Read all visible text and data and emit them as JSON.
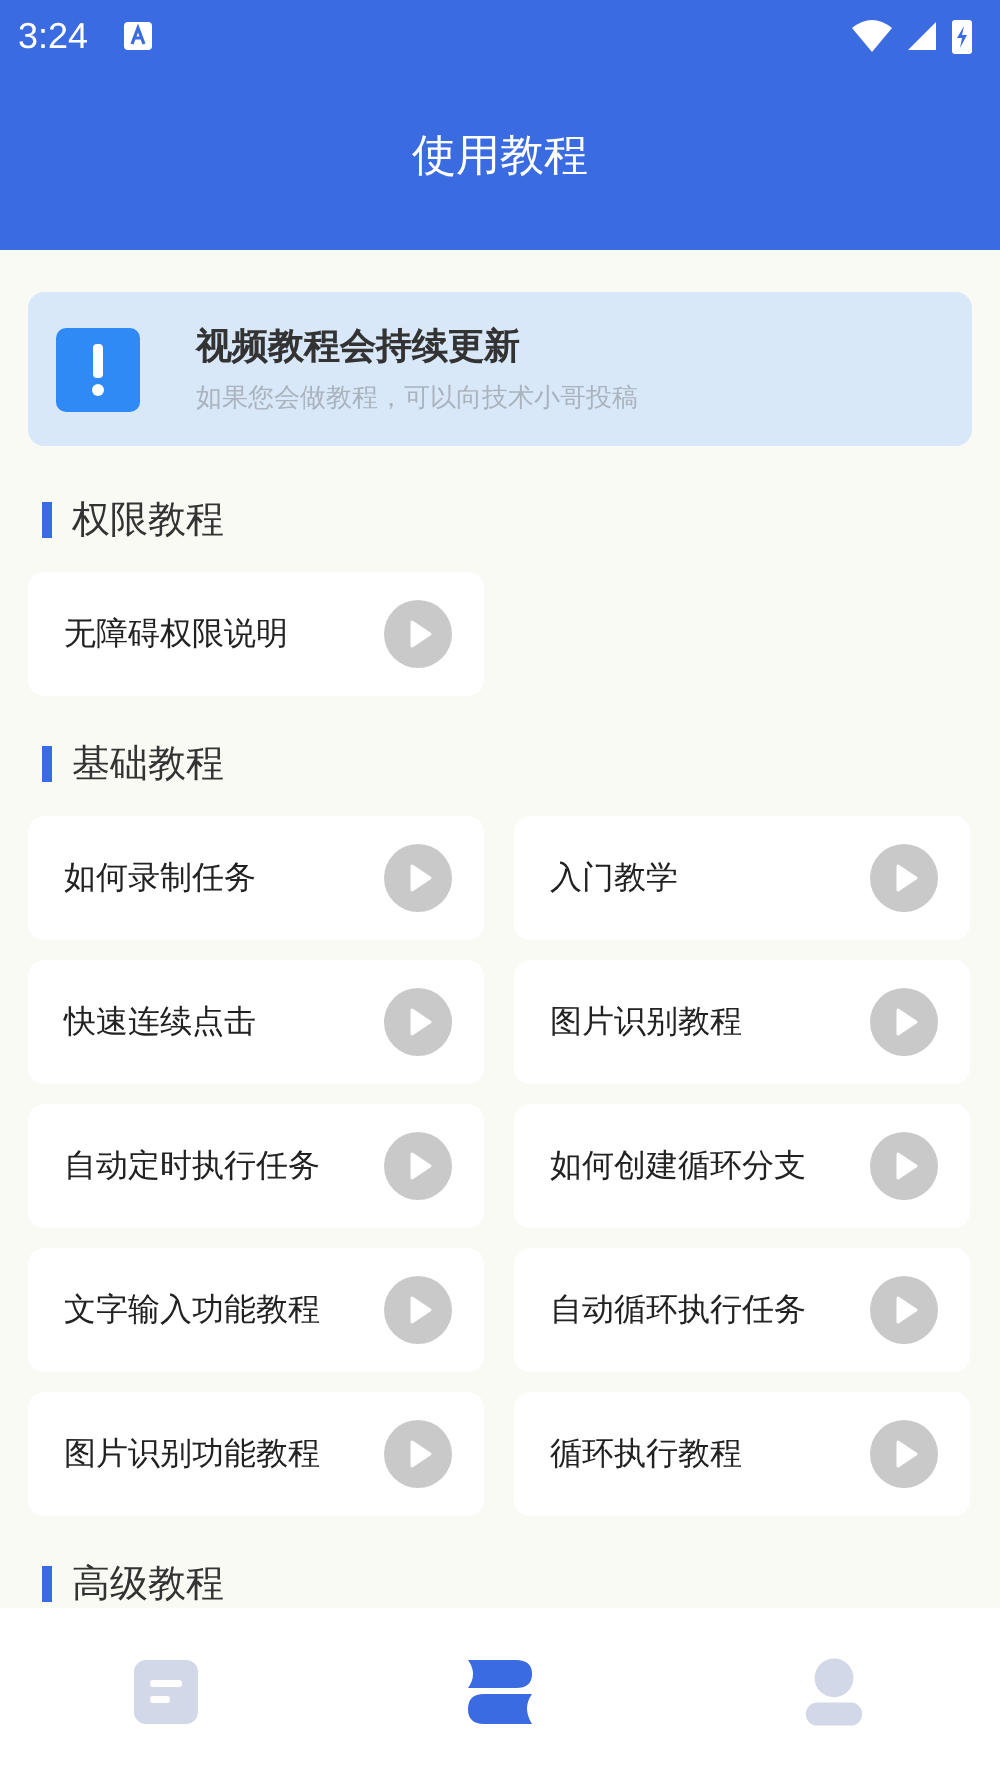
{
  "status_bar": {
    "time": "3:24"
  },
  "header": {
    "title": "使用教程"
  },
  "notice": {
    "title": "视频教程会持续更新",
    "subtitle": "如果您会做教程，可以向技术小哥投稿"
  },
  "sections": [
    {
      "title": "权限教程",
      "items": [
        {
          "label": "无障碍权限说明"
        }
      ]
    },
    {
      "title": "基础教程",
      "items": [
        {
          "label": "如何录制任务"
        },
        {
          "label": "入门教学"
        },
        {
          "label": "快速连续点击"
        },
        {
          "label": "图片识别教程"
        },
        {
          "label": "自动定时执行任务"
        },
        {
          "label": "如何创建循环分支"
        },
        {
          "label": "文字输入功能教程"
        },
        {
          "label": "自动循环执行任务"
        },
        {
          "label": "图片识别功能教程"
        },
        {
          "label": "循环执行教程"
        }
      ]
    },
    {
      "title": "高级教程"
    }
  ],
  "bottom_nav": [
    {
      "kind": "document",
      "selected": false
    },
    {
      "kind": "tutorial",
      "selected": true
    },
    {
      "kind": "profile",
      "selected": false
    }
  ]
}
